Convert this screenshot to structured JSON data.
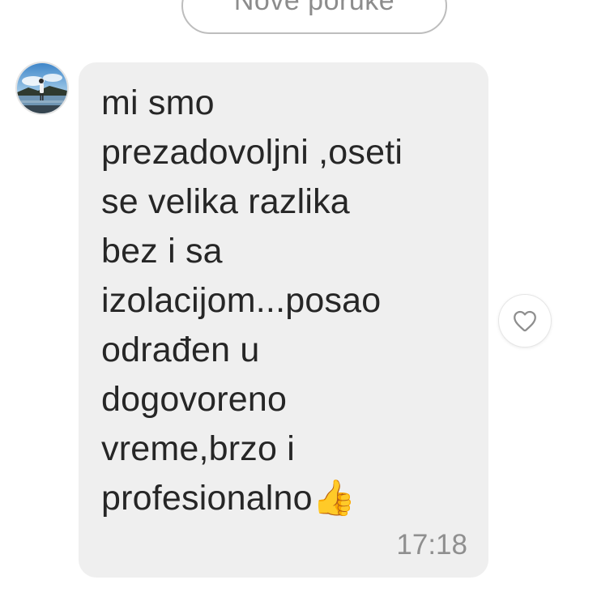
{
  "header": {
    "new_messages_label": "Nove poruke"
  },
  "message": {
    "avatar_icon": "user-avatar",
    "text": "mi smo\nprezadovoljni ,oseti\nse velika razlika\nbez i sa\nizolacijom...posao\nodrađen u\ndogovoreno\nvreme,brzo i\nprofesionalno👍",
    "time": "17:18",
    "bubble_color": "#efefef",
    "text_color": "#262626"
  },
  "actions": {
    "like_icon": "heart-icon"
  }
}
